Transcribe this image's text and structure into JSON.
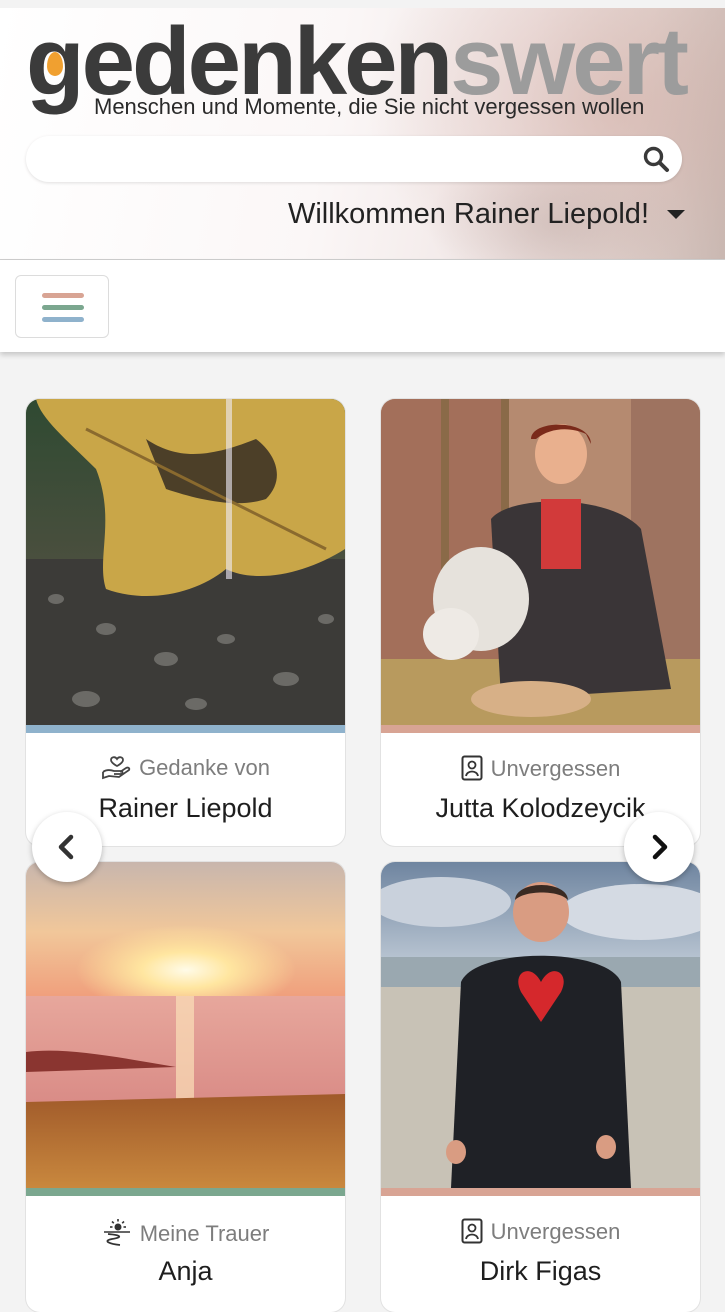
{
  "brand": {
    "logo_part1": "gedenken",
    "logo_part2": "swert",
    "tagline": "Menschen und Momente, die Sie nicht vergessen wollen"
  },
  "search": {
    "placeholder": "",
    "icon": "search-icon"
  },
  "user": {
    "welcome": "Willkommen Rainer Liepold!"
  },
  "colors": {
    "stripe_blue": "#8fb2cc",
    "stripe_rose": "#d8a494",
    "stripe_green": "#7ba78f",
    "drop": "#f0a030"
  },
  "cards": [
    {
      "category": "Gedanke von",
      "name": "Rainer Liepold",
      "icon": "heart-hand-icon"
    },
    {
      "category": "Unvergessen",
      "name": "Jutta Kolodzeycik",
      "icon": "portrait-icon"
    },
    {
      "category": "Meine Trauer",
      "name": "Anja",
      "icon": "sunset-path-icon"
    },
    {
      "category": "Unvergessen",
      "name": "Dirk Figas",
      "icon": "portrait-icon"
    }
  ]
}
